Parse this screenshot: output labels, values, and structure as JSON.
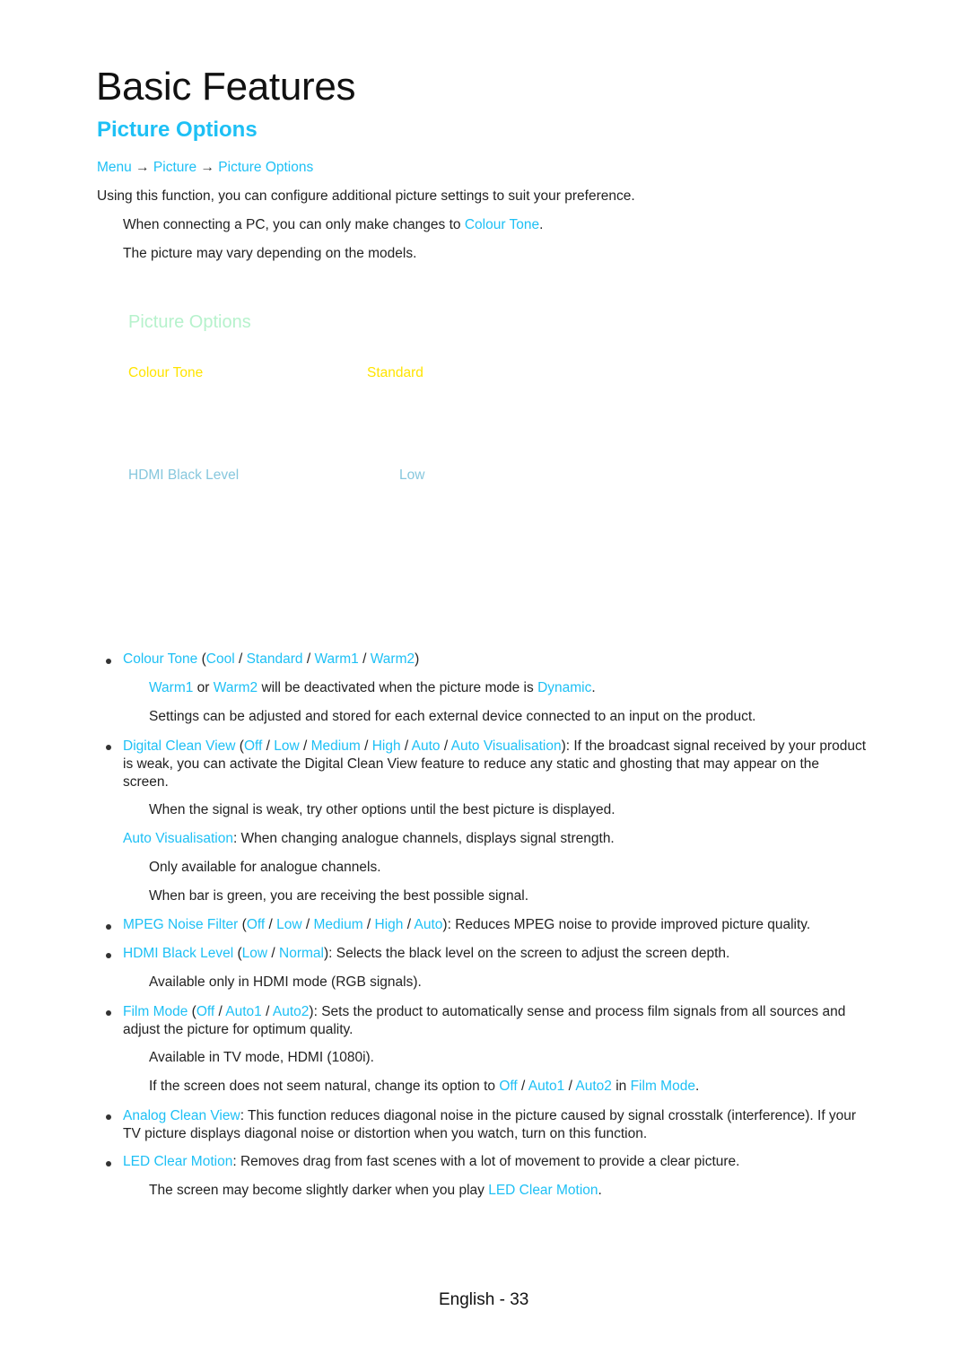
{
  "page": {
    "chapter_title": "Basic Features",
    "section_title": "Picture Options",
    "breadcrumb": [
      "Menu",
      "Picture",
      "Picture Options"
    ],
    "breadcrumb_separator": "→",
    "intro": "Using this function, you can configure additional picture settings to suit your preference.",
    "notes": {
      "pc_note_prefix": "When connecting a PC, you can only make changes to ",
      "pc_note_link": "Colour Tone",
      "pc_note_suffix": ".",
      "model_note": "The picture may vary depending on the models."
    },
    "footer": "English - 33"
  },
  "menu_screen": {
    "title": "Picture Options",
    "rows": [
      {
        "label": "Colour Tone",
        "value": "Standard",
        "selected": true
      },
      {
        "label": "HDMI Black Level",
        "value": "Low",
        "selected": false
      }
    ]
  },
  "items": {
    "colour_tone": {
      "name": "Colour Tone",
      "options": [
        "Cool",
        "Standard",
        "Warm1",
        "Warm2"
      ],
      "note1": {
        "a": "Warm1",
        "or": " or ",
        "b": "Warm2",
        "text": " will be deactivated when the picture mode is ",
        "mode": "Dynamic",
        "end": "."
      },
      "note2": "Settings can be adjusted and stored for each external device connected to an input on the product."
    },
    "digital_clean_view": {
      "name": "Digital Clean View",
      "options": [
        "Off",
        "Low",
        "Medium",
        "High",
        "Auto",
        "Auto Visualisation"
      ],
      "desc": ": If the broadcast signal received by your product is weak, you can activate the Digital Clean View feature to reduce any static and ghosting that may appear on the screen.",
      "note1": "When the signal is weak, try other options until the best picture is displayed.",
      "sub_name": "Auto Visualisation",
      "sub_desc": ": When changing analogue channels, displays signal strength.",
      "note2": "Only available for analogue channels.",
      "note3": "When bar is green, you are receiving the best possible signal."
    },
    "mpeg_noise_filter": {
      "name": "MPEG Noise Filter",
      "options": [
        "Off",
        "Low",
        "Medium",
        "High",
        "Auto"
      ],
      "desc": ": Reduces MPEG noise to provide improved picture quality."
    },
    "hdmi_black_level": {
      "name": "HDMI Black Level",
      "options": [
        "Low",
        "Normal"
      ],
      "desc": ": Selects the black level on the screen to adjust the screen depth.",
      "note1": "Available only in HDMI mode (RGB signals)."
    },
    "film_mode": {
      "name": "Film Mode",
      "options": [
        "Off",
        "Auto1",
        "Auto2"
      ],
      "desc": ": Sets the product to automatically sense and process film signals from all sources and adjust the picture for optimum quality.",
      "note1": "Available in TV mode, HDMI (1080i).",
      "note2_prefix": "If the screen does not seem natural, change its option to ",
      "note2_in": " in ",
      "note2_end": "."
    },
    "analog_clean_view": {
      "name": "Analog Clean View",
      "desc": ": This function reduces diagonal noise in the picture caused by signal crosstalk (interference). If your TV picture displays diagonal noise or distortion when you watch, turn on this function."
    },
    "led_clear_motion": {
      "name": "LED Clear Motion",
      "desc": ": Removes drag from fast scenes with a lot of movement to provide a clear picture.",
      "note_prefix": "The screen may become slightly darker when you play ",
      "note_end": "."
    }
  },
  "punct": {
    "open": " (",
    "close": ")",
    "slash": " / "
  },
  "colors": {
    "accent": "#1ec0f5",
    "menu_title": "#b6f2cc",
    "menu_selected": "#ffe400",
    "menu_item": "#87c7dd"
  }
}
